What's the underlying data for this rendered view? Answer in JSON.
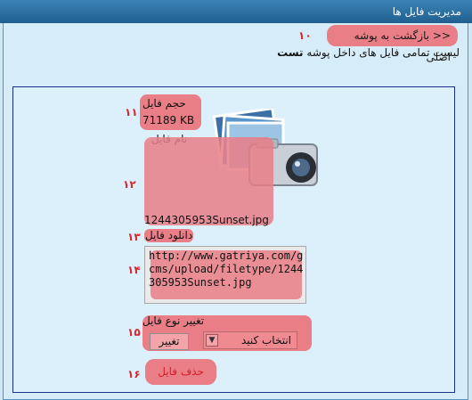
{
  "window": {
    "title": "مدیریت فایل ها"
  },
  "nav": {
    "back_label": "<< بازگشت به پوشه اصلی"
  },
  "header": {
    "subtitle_prefix": "لیست تمامی فایل های داخل پوشه",
    "folder_name": "تست"
  },
  "markers": {
    "m10": "۱۰",
    "m11": "۱۱",
    "m12": "۱۲",
    "m13": "۱۳",
    "m14": "۱۴",
    "m15": "۱۵",
    "m16": "۱۶"
  },
  "file": {
    "size_label": "حجم فایل",
    "size_value": "71189 KB",
    "name_label": "نام فایل",
    "name_value": "1244305953Sunset.jpg",
    "download_label": "دانلود فایل",
    "url": "http://www.gatriya.com/gcms/upload/filetype/1244305953Sunset.jpg",
    "change_type_label": "تغییر نوع فایل",
    "select_value": "انتخاب کنید",
    "change_button": "تغییر",
    "delete_label": "حذف فایل"
  },
  "icons": {
    "file_preview": "camera-photos-icon",
    "dropdown": "chevron-down-icon"
  },
  "colors": {
    "title_bar": "#2b6ea3",
    "highlight": "#e97e86",
    "border": "#1c2f8f",
    "background": "#d6ecf8"
  }
}
